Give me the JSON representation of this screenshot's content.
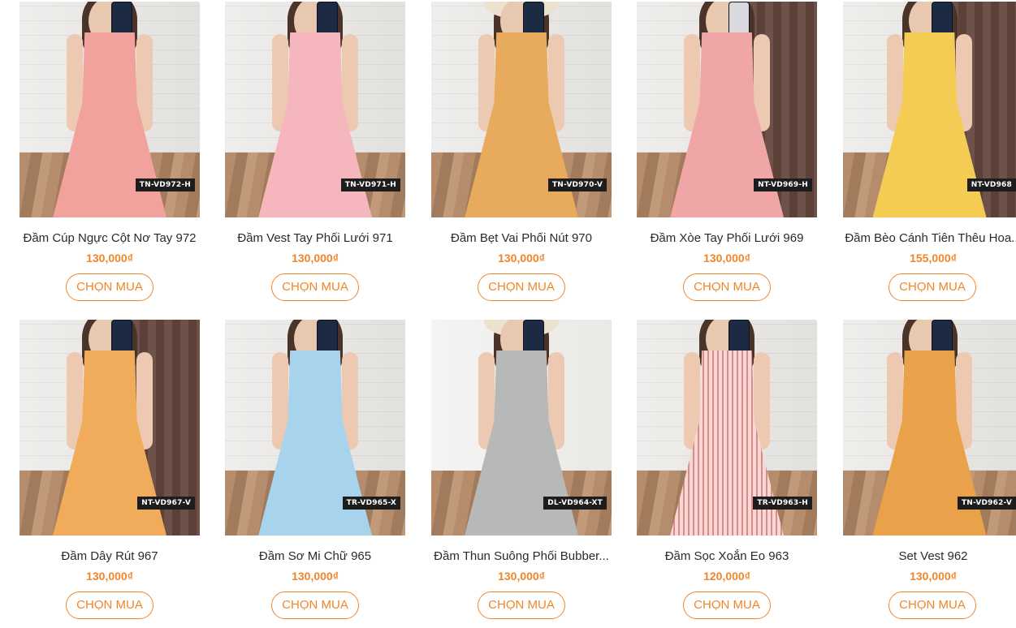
{
  "products": [
    {
      "sku": "TN-VD972-H",
      "name": "Đầm Cúp Ngực Cột Nơ Tay 972",
      "price": "130,000₫",
      "button": "CHỌN MUA",
      "color": "#f1a29c",
      "scene": "wall",
      "hat": false
    },
    {
      "sku": "TN-VD971-H",
      "name": "Đầm Vest Tay Phối Lưới 971",
      "price": "130,000₫",
      "button": "CHỌN MUA",
      "color": "#f5b6bd",
      "scene": "wall",
      "hat": false
    },
    {
      "sku": "TN-VD970-V",
      "name": "Đầm Bẹt Vai Phối Nút 970",
      "price": "130,000₫",
      "button": "CHỌN MUA",
      "color": "#e8aa5c",
      "scene": "wall",
      "hat": true
    },
    {
      "sku": "NT-VD969-H",
      "name": "Đầm Xòe Tay Phối Lưới 969",
      "price": "130,000₫",
      "button": "CHỌN MUA",
      "color": "#f0a6a6",
      "scene": "curtain",
      "hat": false
    },
    {
      "sku": "NT-VD968",
      "name": "Đầm Bèo Cánh Tiên Thêu Hoa...",
      "price": "155,000₫",
      "button": "CHỌN MUA",
      "color": "#f4cc54",
      "scene": "curtain",
      "hat": false
    },
    {
      "sku": "NT-VD967-V",
      "name": "Đầm Dây Rút 967",
      "price": "130,000₫",
      "button": "CHỌN MUA",
      "color": "#f0ac5a",
      "scene": "curtain",
      "hat": false
    },
    {
      "sku": "TR-VD965-X",
      "name": "Đầm Sơ Mi Chữ 965",
      "price": "130,000₫",
      "button": "CHỌN MUA",
      "color": "#a8d3ec",
      "scene": "wall",
      "hat": false
    },
    {
      "sku": "DL-VD964-XT",
      "name": "Đầm Thun Suông Phối Bubber...",
      "price": "130,000₫",
      "button": "CHỌN MUA",
      "color": "#b7b9b8",
      "scene": "wall",
      "hat": true
    },
    {
      "sku": "TR-VD963-H",
      "name": "Đầm Sọc Xoắn Eo 963",
      "price": "120,000₫",
      "button": "CHỌN MUA",
      "color": "#eab2b0",
      "scene": "wall",
      "hat": false
    },
    {
      "sku": "TN-VD962-V",
      "name": "Set Vest 962",
      "price": "130,000₫",
      "button": "CHỌN MUA",
      "color": "#eaa24a",
      "scene": "wall",
      "hat": false
    }
  ]
}
